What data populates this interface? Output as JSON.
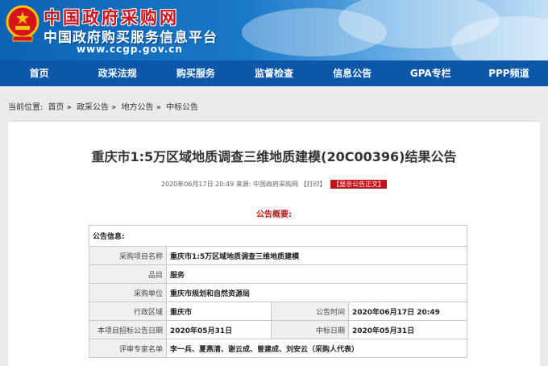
{
  "header": {
    "title": "中国政府采购网",
    "subtitle": "中国政府购买服务信息平台",
    "url": "www.ccgp.gov.cn"
  },
  "nav": [
    "首页",
    "政采法规",
    "购买服务",
    "监督检查",
    "信息公告",
    "GPA专栏",
    "PPP频道"
  ],
  "breadcrumb": {
    "prefix": "当前位置:",
    "items": [
      "首页",
      "政采公告",
      "地方公告",
      "中标公告"
    ],
    "separator": "»"
  },
  "notice": {
    "title": "重庆市1:5万区域地质调查三维地质建模(20C00396)结果公告",
    "meta_prefix": "2020年06月17日 20:49 来源:",
    "source": "中国政府采购网",
    "print": "【打印】",
    "full_text": "【显示公告正文】",
    "summary_label": "公告概要:"
  },
  "table": {
    "header": "公告信息:",
    "project_name_label": "采购项目名称",
    "project_name": "重庆市1:5万区域地质调查三维地质建模",
    "category_label": "品目",
    "category": "服务",
    "purchaser_label": "采购单位",
    "purchaser": "重庆市规划和自然资源局",
    "region_label": "行政区域",
    "region": "重庆市",
    "publish_time_label": "公告时间",
    "publish_time": "2020年06月17日 20:49",
    "tender_date_label": "本项目招标公告日期",
    "tender_date": "2020年05月31日",
    "award_date_label": "中标日期",
    "award_date": "2020年05月31日",
    "experts_label": "评审专家名单",
    "experts": "李一兵、夏燕清、谢云成、曾建成、刘安云（采购人代表）"
  },
  "colors": {
    "nav_bg": "#0c57a8",
    "title_red": "#d0141b",
    "accent_red": "#c1151b"
  }
}
